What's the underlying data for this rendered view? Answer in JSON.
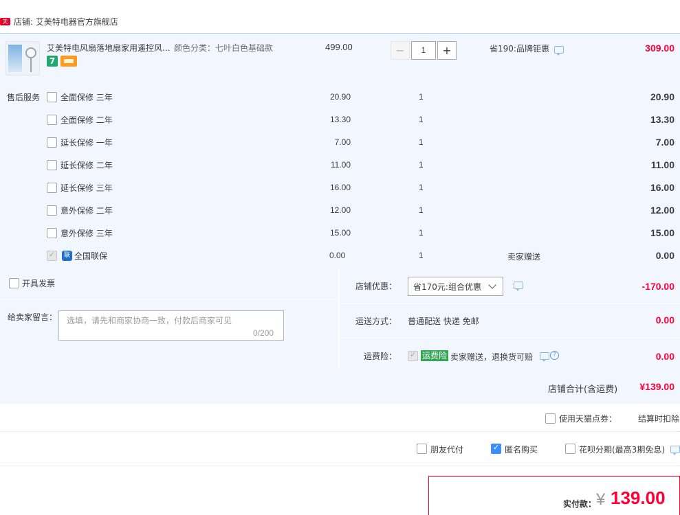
{
  "shop": {
    "tmall_badge": "天猫",
    "label": "店铺: 艾美特电器官方旗舰店"
  },
  "product": {
    "title": "艾美特电风扇落地扇家用遥控风...",
    "attr": "颜色分类：七叶白色基础款",
    "badge7": "7",
    "price": "499.00",
    "qty": "1",
    "qty_minus": "−",
    "qty_plus": "+",
    "promo": "省190:品牌钜惠",
    "subtotal": "309.00"
  },
  "services": {
    "label": "售后服务",
    "items": [
      {
        "name": "全面保修 三年",
        "price": "20.90",
        "qty": "1",
        "subtotal": "20.90"
      },
      {
        "name": "全面保修 二年",
        "price": "13.30",
        "qty": "1",
        "subtotal": "13.30"
      },
      {
        "name": "延长保修 一年",
        "price": "7.00",
        "qty": "1",
        "subtotal": "7.00"
      },
      {
        "name": "延长保修 二年",
        "price": "11.00",
        "qty": "1",
        "subtotal": "11.00"
      },
      {
        "name": "延长保修 三年",
        "price": "16.00",
        "qty": "1",
        "subtotal": "16.00"
      },
      {
        "name": "意外保修 二年",
        "price": "12.00",
        "qty": "1",
        "subtotal": "12.00"
      },
      {
        "name": "意外保修 三年",
        "price": "15.00",
        "qty": "1",
        "subtotal": "15.00"
      }
    ],
    "lianbao": {
      "icon": "联",
      "name": "全国联保",
      "price": "0.00",
      "qty": "1",
      "note": "卖家赠送",
      "subtotal": "0.00"
    }
  },
  "invoice": {
    "label": "开具发票"
  },
  "message": {
    "label": "给卖家留言：",
    "placeholder": "选填，请先和商家协商一致，付款后商家可见",
    "count": "0/200"
  },
  "discount": {
    "label": "店铺优惠：",
    "selected": "省170元:组合优惠",
    "amount": "-170.00"
  },
  "shipping": {
    "label": "运送方式：",
    "value": "普通配送 快递 免邮",
    "amount": "0.00"
  },
  "insurance": {
    "label": "运费险：",
    "tag": "运费险",
    "desc": "卖家赠送，退换货可赔",
    "help": "?",
    "amount": "0.00"
  },
  "shop_total": {
    "label": "店铺合计(含运费)",
    "value": "¥139.00"
  },
  "points": {
    "label": "使用天猫点券：",
    "note": "结算时扣除"
  },
  "options": {
    "friend_pay": "朋友代付",
    "anonymous": "匿名购买",
    "huabei": "花呗分期(最高3期免息)"
  },
  "payment": {
    "label": "实付款：",
    "currency": "¥",
    "amount": "139.00"
  },
  "colors": {
    "accent_red": "#ff0036",
    "light_blue_bg": "#f2f7ff",
    "check_blue": "#3b8ffa"
  }
}
